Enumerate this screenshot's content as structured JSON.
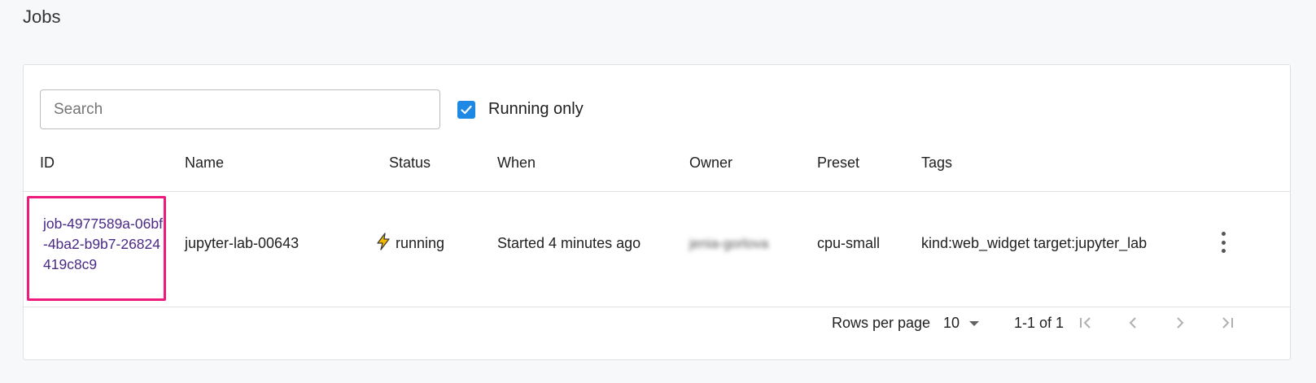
{
  "page": {
    "title": "Jobs"
  },
  "toolbar": {
    "search_placeholder": "Search",
    "search_value": "",
    "running_only_label": "Running only",
    "running_only_checked": true
  },
  "table": {
    "headers": {
      "id": "ID",
      "name": "Name",
      "status": "Status",
      "when": "When",
      "owner": "Owner",
      "preset": "Preset",
      "tags": "Tags"
    },
    "rows": [
      {
        "id": "job-4977589a-06bf-4ba2-b9b7-26824419c8c9",
        "name": "jupyter-lab-00643",
        "status": "running",
        "status_icon": "lightning-icon",
        "when": "Started 4 minutes ago",
        "owner": "jenia-gorlova",
        "preset": "cpu-small",
        "tags": "kind:web_widget target:jupyter_lab"
      }
    ]
  },
  "pagination": {
    "rows_per_page_label": "Rows per page",
    "rows_per_page_value": "10",
    "range_text": "1-1 of 1"
  },
  "colors": {
    "accent": "#1e88e5",
    "highlight_border": "#ee1a7e",
    "link": "#4a2a86",
    "status_icon": "#f5b800"
  }
}
